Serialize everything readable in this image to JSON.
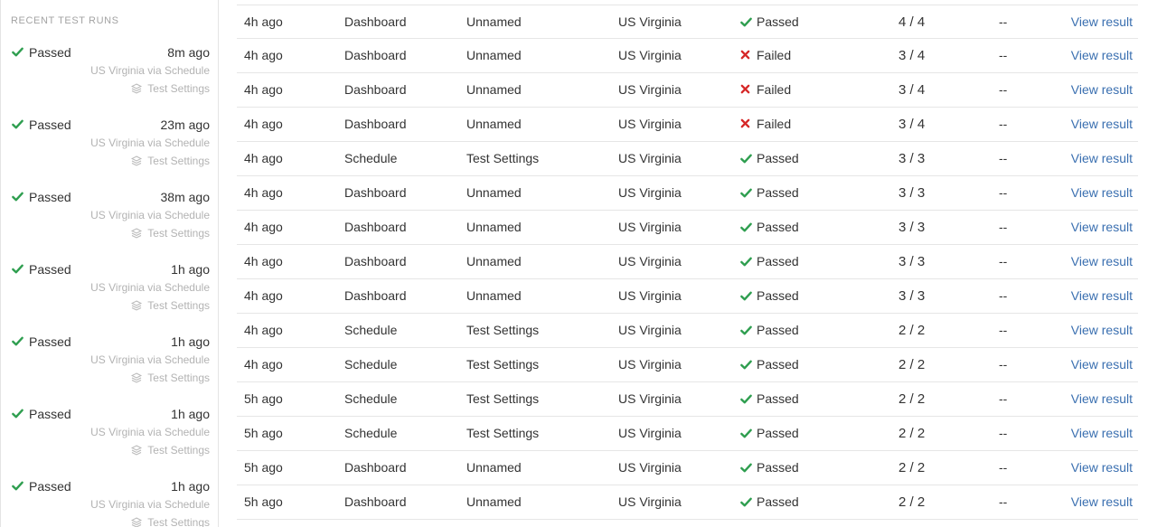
{
  "sidebar": {
    "title": "RECENT TEST RUNS",
    "runs": [
      {
        "status": "Passed",
        "time": "8m ago",
        "location": "US Virginia via Schedule",
        "settings": "Test Settings"
      },
      {
        "status": "Passed",
        "time": "23m ago",
        "location": "US Virginia via Schedule",
        "settings": "Test Settings"
      },
      {
        "status": "Passed",
        "time": "38m ago",
        "location": "US Virginia via Schedule",
        "settings": "Test Settings"
      },
      {
        "status": "Passed",
        "time": "1h ago",
        "location": "US Virginia via Schedule",
        "settings": "Test Settings"
      },
      {
        "status": "Passed",
        "time": "1h ago",
        "location": "US Virginia via Schedule",
        "settings": "Test Settings"
      },
      {
        "status": "Passed",
        "time": "1h ago",
        "location": "US Virginia via Schedule",
        "settings": "Test Settings"
      },
      {
        "status": "Passed",
        "time": "1h ago",
        "location": "US Virginia via Schedule",
        "settings": "Test Settings"
      }
    ]
  },
  "table": {
    "link_label": "View result",
    "rows": [
      {
        "time": "4h ago",
        "trigger": "Dashboard",
        "name": "Unnamed",
        "location": "US Virginia",
        "status": "Passed",
        "score": "4 / 4",
        "extra": "--"
      },
      {
        "time": "4h ago",
        "trigger": "Dashboard",
        "name": "Unnamed",
        "location": "US Virginia",
        "status": "Failed",
        "score": "3 / 4",
        "extra": "--"
      },
      {
        "time": "4h ago",
        "trigger": "Dashboard",
        "name": "Unnamed",
        "location": "US Virginia",
        "status": "Failed",
        "score": "3 / 4",
        "extra": "--"
      },
      {
        "time": "4h ago",
        "trigger": "Dashboard",
        "name": "Unnamed",
        "location": "US Virginia",
        "status": "Failed",
        "score": "3 / 4",
        "extra": "--"
      },
      {
        "time": "4h ago",
        "trigger": "Schedule",
        "name": "Test Settings",
        "location": "US Virginia",
        "status": "Passed",
        "score": "3 / 3",
        "extra": "--"
      },
      {
        "time": "4h ago",
        "trigger": "Dashboard",
        "name": "Unnamed",
        "location": "US Virginia",
        "status": "Passed",
        "score": "3 / 3",
        "extra": "--"
      },
      {
        "time": "4h ago",
        "trigger": "Dashboard",
        "name": "Unnamed",
        "location": "US Virginia",
        "status": "Passed",
        "score": "3 / 3",
        "extra": "--"
      },
      {
        "time": "4h ago",
        "trigger": "Dashboard",
        "name": "Unnamed",
        "location": "US Virginia",
        "status": "Passed",
        "score": "3 / 3",
        "extra": "--"
      },
      {
        "time": "4h ago",
        "trigger": "Dashboard",
        "name": "Unnamed",
        "location": "US Virginia",
        "status": "Passed",
        "score": "3 / 3",
        "extra": "--"
      },
      {
        "time": "4h ago",
        "trigger": "Schedule",
        "name": "Test Settings",
        "location": "US Virginia",
        "status": "Passed",
        "score": "2 / 2",
        "extra": "--"
      },
      {
        "time": "4h ago",
        "trigger": "Schedule",
        "name": "Test Settings",
        "location": "US Virginia",
        "status": "Passed",
        "score": "2 / 2",
        "extra": "--"
      },
      {
        "time": "5h ago",
        "trigger": "Schedule",
        "name": "Test Settings",
        "location": "US Virginia",
        "status": "Passed",
        "score": "2 / 2",
        "extra": "--"
      },
      {
        "time": "5h ago",
        "trigger": "Schedule",
        "name": "Test Settings",
        "location": "US Virginia",
        "status": "Passed",
        "score": "2 / 2",
        "extra": "--"
      },
      {
        "time": "5h ago",
        "trigger": "Dashboard",
        "name": "Unnamed",
        "location": "US Virginia",
        "status": "Passed",
        "score": "2 / 2",
        "extra": "--"
      },
      {
        "time": "5h ago",
        "trigger": "Dashboard",
        "name": "Unnamed",
        "location": "US Virginia",
        "status": "Passed",
        "score": "2 / 2",
        "extra": "--"
      }
    ]
  },
  "colors": {
    "passed": "#2e9e4f",
    "failed": "#d62828",
    "link": "#3a6fb0",
    "muted": "#b3b3b3"
  },
  "icons": {
    "passed": "check-icon",
    "failed": "cross-icon",
    "settings": "layers-icon"
  }
}
